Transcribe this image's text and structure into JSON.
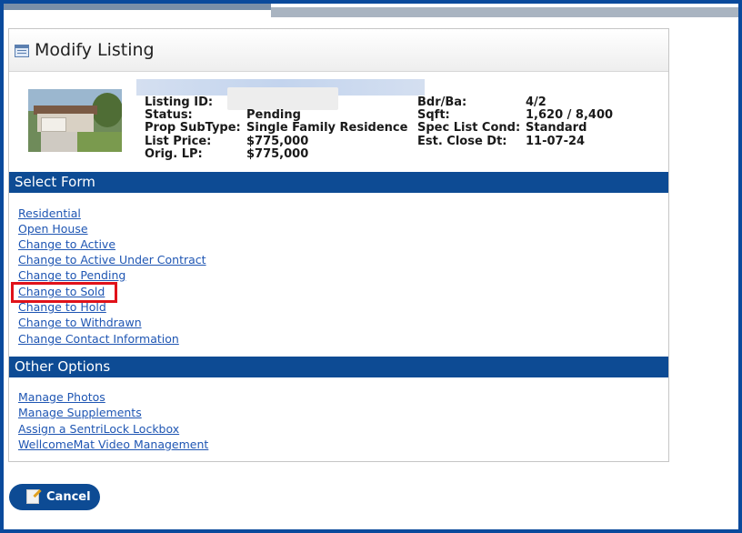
{
  "panel": {
    "title": "Modify Listing"
  },
  "listing": {
    "left": [
      {
        "label": "Listing ID:",
        "value": ""
      },
      {
        "label": "Status:",
        "value": "Pending"
      },
      {
        "label": "Prop SubType:",
        "value": "Single Family Residence"
      },
      {
        "label": "List Price:",
        "value": "$775,000"
      },
      {
        "label": "Orig. LP:",
        "value": "$775,000"
      }
    ],
    "right": [
      {
        "label": "Bdr/Ba:",
        "value": "4/2"
      },
      {
        "label": "Sqft:",
        "value": "1,620 / 8,400"
      },
      {
        "label": "Spec List Cond:",
        "value": "Standard"
      },
      {
        "label": "Est. Close Dt:",
        "value": "11-07-24"
      }
    ]
  },
  "select_form": {
    "title": "Select Form",
    "links": [
      "Residential",
      "Open House",
      "Change to Active",
      "Change to Active Under Contract",
      "Change to Pending",
      "Change to Sold",
      "Change to Hold",
      "Change to Withdrawn",
      "Change Contact Information"
    ]
  },
  "other_options": {
    "title": "Other Options",
    "links": [
      "Manage Photos",
      "Manage Supplements",
      "Assign a SentriLock Lockbox",
      "WellcomeMat Video Management"
    ]
  },
  "cancel_button": {
    "label": "Cancel",
    "icon": "edit-cancel-icon"
  },
  "colors": {
    "frame": "#0a4a9c",
    "section_bar": "#0d4b94",
    "link": "#1f56b3",
    "highlight": "#e0121a"
  }
}
